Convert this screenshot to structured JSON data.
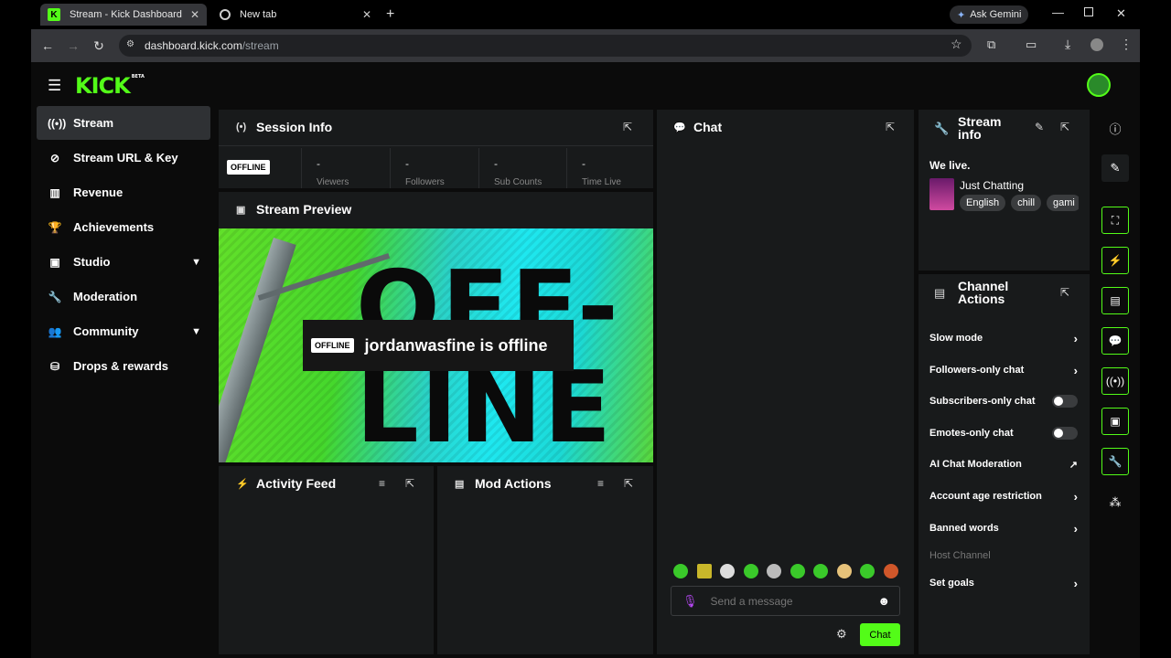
{
  "browser": {
    "tabs": [
      {
        "title": "Stream - Kick Dashboard",
        "favicon": "kick-logo-icon"
      },
      {
        "title": "New tab",
        "favicon": "chrome-icon"
      }
    ],
    "ask_gemini": "Ask Gemini",
    "url_host": "dashboard.kick.com",
    "url_path": "/stream"
  },
  "app": {
    "logo": "KICK",
    "logo_badge": "BETA",
    "sidebar": {
      "items": [
        {
          "label": "Stream",
          "icon": "broadcast-icon"
        },
        {
          "label": "Stream URL & Key",
          "icon": "link-icon"
        },
        {
          "label": "Revenue",
          "icon": "chart-icon"
        },
        {
          "label": "Achievements",
          "icon": "trophy-icon"
        },
        {
          "label": "Studio",
          "icon": "studio-icon"
        },
        {
          "label": "Moderation",
          "icon": "wrench-icon"
        },
        {
          "label": "Community",
          "icon": "people-icon"
        },
        {
          "label": "Drops & rewards",
          "icon": "drops-icon"
        }
      ]
    },
    "session": {
      "title": "Session Info",
      "status_badge": "OFFLINE",
      "stats": [
        {
          "value": "-",
          "label": "Viewers"
        },
        {
          "value": "-",
          "label": "Followers"
        },
        {
          "value": "-",
          "label": "Sub Counts"
        },
        {
          "value": "-",
          "label": "Time Live"
        }
      ]
    },
    "preview": {
      "title": "Stream Preview",
      "bg_text": "OFF-LINE",
      "badge": "OFFLINE",
      "message": "jordanwasfine is offline"
    },
    "activity": {
      "title": "Activity Feed"
    },
    "mod_actions": {
      "title": "Mod Actions"
    },
    "chat": {
      "title": "Chat",
      "placeholder": "Send a message",
      "send_label": "Chat"
    },
    "stream_info": {
      "title": "Stream\ninfo",
      "title_line1": "Stream",
      "title_line2": "info",
      "stream_title": "We live.",
      "category": "Just Chatting",
      "tags": [
        "English",
        "chill",
        "gami"
      ]
    },
    "channel_actions": {
      "title_line1": "Channel",
      "title_line2": "Actions",
      "rows": [
        {
          "label": "Slow mode",
          "control": "chevron"
        },
        {
          "label": "Followers-only chat",
          "control": "chevron"
        },
        {
          "label": "Subscribers-only chat",
          "control": "toggle-off"
        },
        {
          "label": "Emotes-only chat",
          "control": "toggle-off"
        },
        {
          "label": "AI Chat Moderation",
          "control": "external-link"
        },
        {
          "label": "Account age restriction",
          "control": "chevron"
        },
        {
          "label": "Banned words",
          "control": "chevron"
        },
        {
          "label": "Host Channel",
          "control": "disabled"
        },
        {
          "label": "Set goals",
          "control": "chevron"
        }
      ]
    },
    "colors": {
      "brand": "#53fc18",
      "panel": "#181a1b",
      "background": "#0b0b0b"
    }
  }
}
